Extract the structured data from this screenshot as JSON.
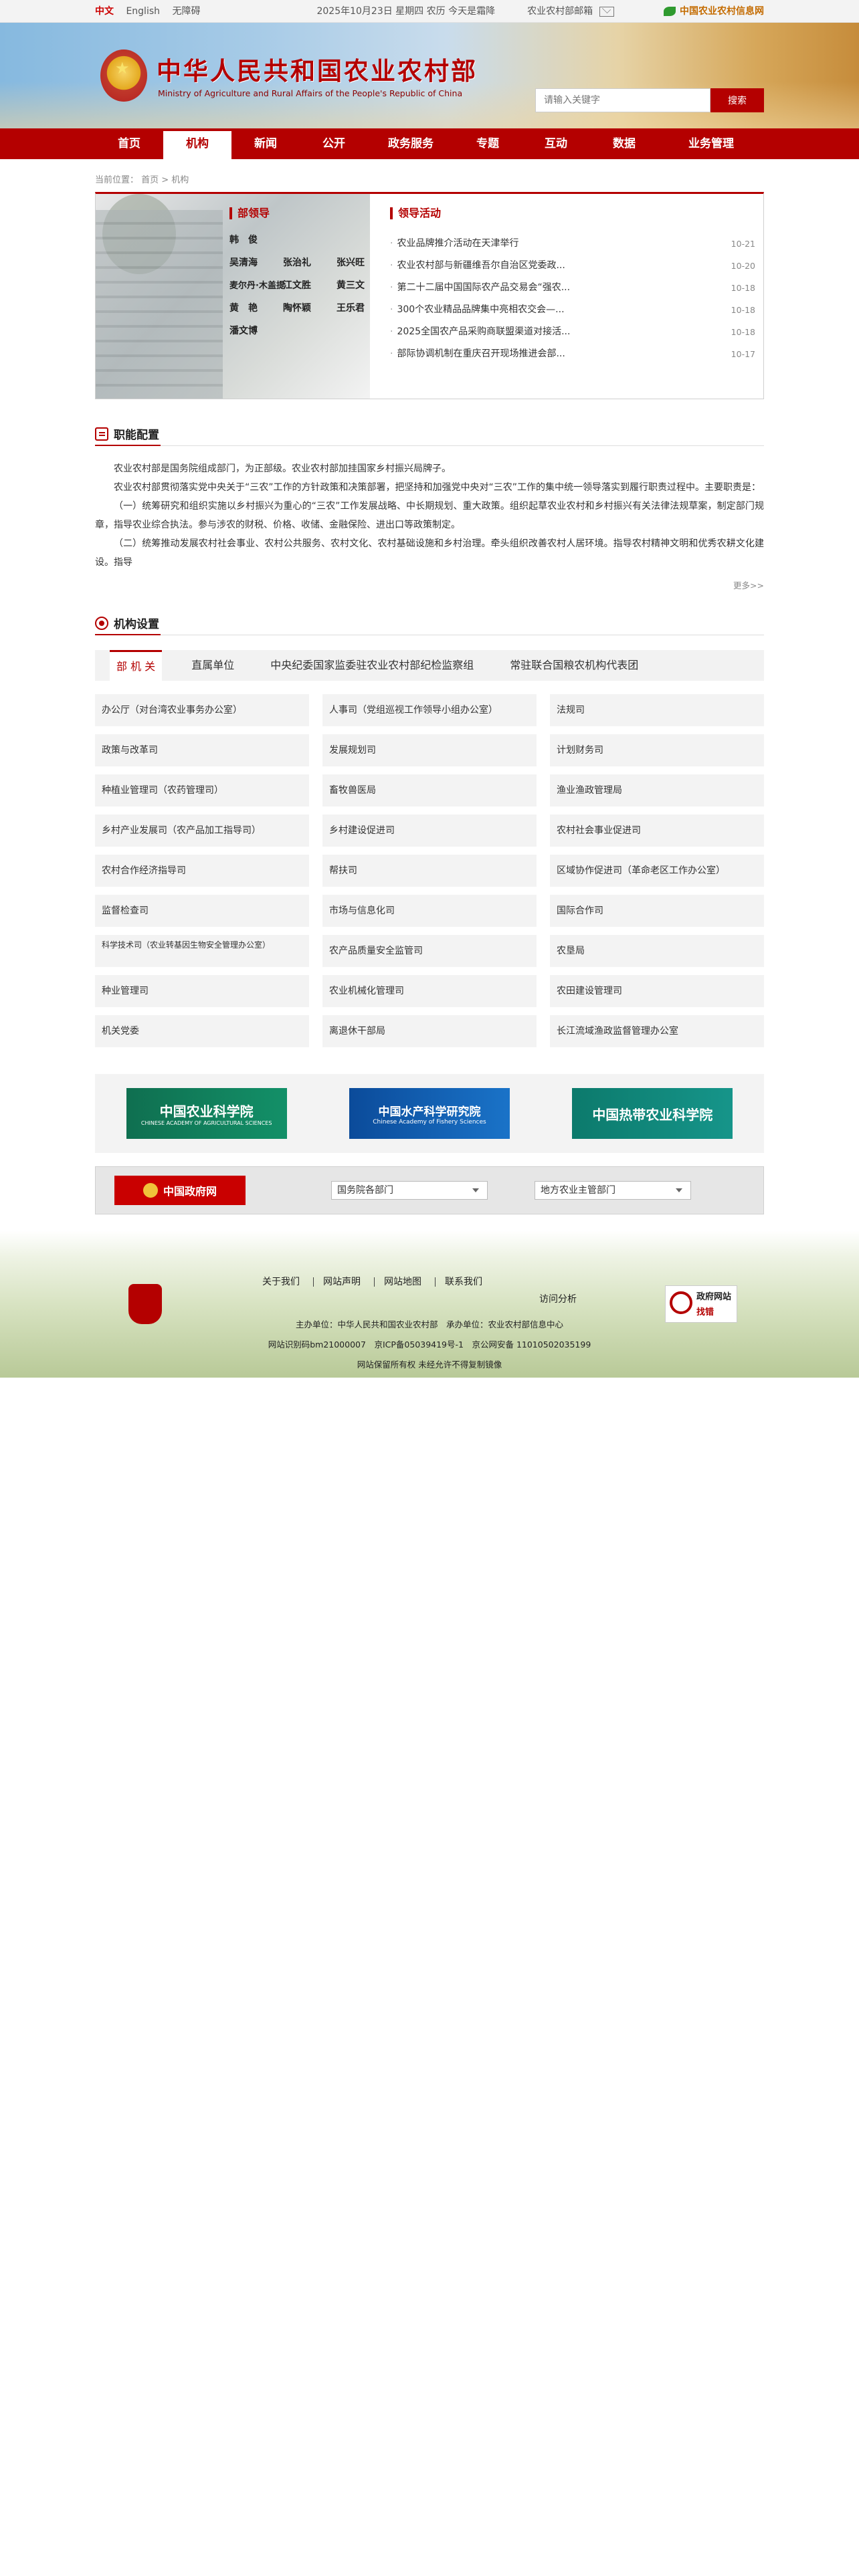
{
  "topbar": {
    "lang_zh": "中文",
    "lang_en": "English",
    "accessibility": "无障碍",
    "date": "2025年10月23日 星期四 农历 今天是霜降",
    "mail": "农业农村部邮箱",
    "info_net": "中国农业农村信息网"
  },
  "header": {
    "title": "中华人民共和国农业农村部",
    "subtitle": "Ministry of Agriculture and Rural Affairs of the People's Republic of China",
    "search_placeholder": "请输入关键字",
    "search_button": "搜索"
  },
  "nav": [
    "首页",
    "机构",
    "新闻",
    "公开",
    "政务服务",
    "专题",
    "互动",
    "数据",
    "业务管理"
  ],
  "breadcrumb": "当前位置： 首页 > 机构",
  "leaders": {
    "title": "部领导",
    "names": [
      "韩　俊",
      "",
      "",
      "吴清海",
      "张治礼",
      "张兴旺",
      "麦尔丹·木盖提",
      "江文胜",
      "黄三文",
      "黄　艳",
      "陶怀颖",
      "王乐君",
      "潘文博",
      "",
      ""
    ]
  },
  "activities": {
    "title": "领导活动",
    "items": [
      {
        "title": "农业品牌推介活动在天津举行",
        "date": "10-21"
      },
      {
        "title": "农业农村部与新疆维吾尔自治区党委政...",
        "date": "10-20"
      },
      {
        "title": "第二十二届中国国际农产品交易会“强农...",
        "date": "10-18"
      },
      {
        "title": "300个农业精品品牌集中亮相农交会—...",
        "date": "10-18"
      },
      {
        "title": "2025全国农产品采购商联盟渠道对接活...",
        "date": "10-18"
      },
      {
        "title": "部际协调机制在重庆召开现场推进会部...",
        "date": "10-17"
      }
    ]
  },
  "duty": {
    "title": "职能配置",
    "paragraphs": [
      "农业农村部是国务院组成部门，为正部级。农业农村部加挂国家乡村振兴局牌子。",
      "农业农村部贯彻落实党中央关于“三农”工作的方针政策和决策部署，把坚持和加强党中央对“三农”工作的集中统一领导落实到履行职责过程中。主要职责是：",
      "（一）统筹研究和组织实施以乡村振兴为重心的“三农”工作发展战略、中长期规划、重大政策。组织起草农业农村和乡村振兴有关法律法规草案，制定部门规章，指导农业综合执法。参与涉农的财税、价格、收储、金融保险、进出口等政策制定。",
      "（二）统筹推动发展农村社会事业、农村公共服务、农村文化、农村基础设施和乡村治理。牵头组织改善农村人居环境。指导农村精神文明和优秀农耕文化建设。指导"
    ],
    "more": "更多>>"
  },
  "org": {
    "title": "机构设置",
    "tabs": [
      "部 机 关",
      "直属单位",
      "中央纪委国家监委驻农业农村部纪检监察组",
      "常驻联合国粮农机构代表团"
    ],
    "units": [
      "办公厅（对台湾农业事务办公室）",
      "人事司（党组巡视工作领导小组办公室）",
      "法规司",
      "政策与改革司",
      "发展规划司",
      "计划财务司",
      "种植业管理司（农药管理司）",
      "畜牧兽医局",
      "渔业渔政管理局",
      "乡村产业发展司（农产品加工指导司）",
      "乡村建设促进司",
      "农村社会事业促进司",
      "农村合作经济指导司",
      "帮扶司",
      "区域协作促进司（革命老区工作办公室）",
      "监督检查司",
      "市场与信息化司",
      "国际合作司",
      "科学技术司（农业转基因生物安全管理办公室）",
      "农产品质量安全监管司",
      "农垦局",
      "种业管理司",
      "农业机械化管理司",
      "农田建设管理司",
      "机关党委",
      "离退休干部局",
      "长江流域渔政监督管理办公室"
    ]
  },
  "partners": [
    {
      "cn": "中国农业科学院",
      "en": "CHINESE ACADEMY OF AGRICULTURAL SCIENCES"
    },
    {
      "cn": "中国水产科学研究院",
      "en": "Chinese Academy of Fishery Sciences"
    },
    {
      "cn": "中国热带农业科学院",
      "en": ""
    }
  ],
  "gov": {
    "logo": "中国政府网",
    "select1": "国务院各部门",
    "select2": "地方农业主管部门"
  },
  "footer": {
    "links": [
      "关于我们",
      "网站声明",
      "网站地图",
      "联系我们"
    ],
    "visit": "访问分析",
    "correct_a": "政府网站",
    "correct_b": "找错",
    "line1": "主办单位：中华人民共和国农业农村部　承办单位：农业农村部信息中心",
    "line2": "网站识别码bm21000007　京ICP备05039419号-1　京公网安备 11010502035199",
    "line3": "网站保留所有权 未经允许不得复制镜像"
  }
}
